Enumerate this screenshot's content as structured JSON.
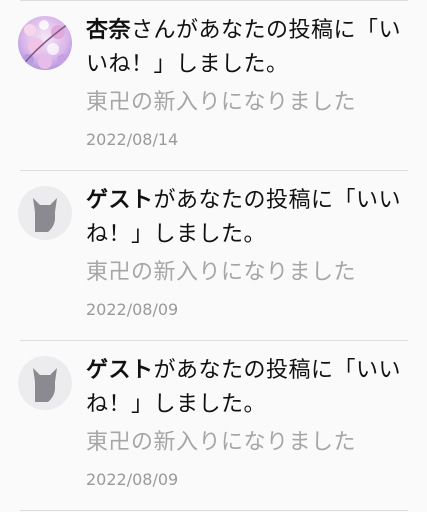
{
  "notifications": [
    {
      "user": "杏奈",
      "action": "さんがあなたの投稿に「いいね！」しました。",
      "detail": "東卍の新入りになりました",
      "date": "2022/08/14",
      "avatar_icon": "photo-avatar-icon"
    },
    {
      "user": "ゲスト",
      "action": "があなたの投稿に「いいね！」しました。",
      "detail": "東卍の新入りになりました",
      "date": "2022/08/09",
      "avatar_icon": "cat-silhouette-icon"
    },
    {
      "user": "ゲスト",
      "action": "があなたの投稿に「いいね！」しました。",
      "detail": "東卍の新入りになりました",
      "date": "2022/08/09",
      "avatar_icon": "cat-silhouette-icon"
    }
  ],
  "colors": {
    "background": "#fafafa",
    "text": "#111111",
    "muted": "#a6a6a6",
    "separator": "#dddddd",
    "guest_avatar_bg": "#ececee",
    "guest_avatar_fg": "#8a8a90"
  }
}
